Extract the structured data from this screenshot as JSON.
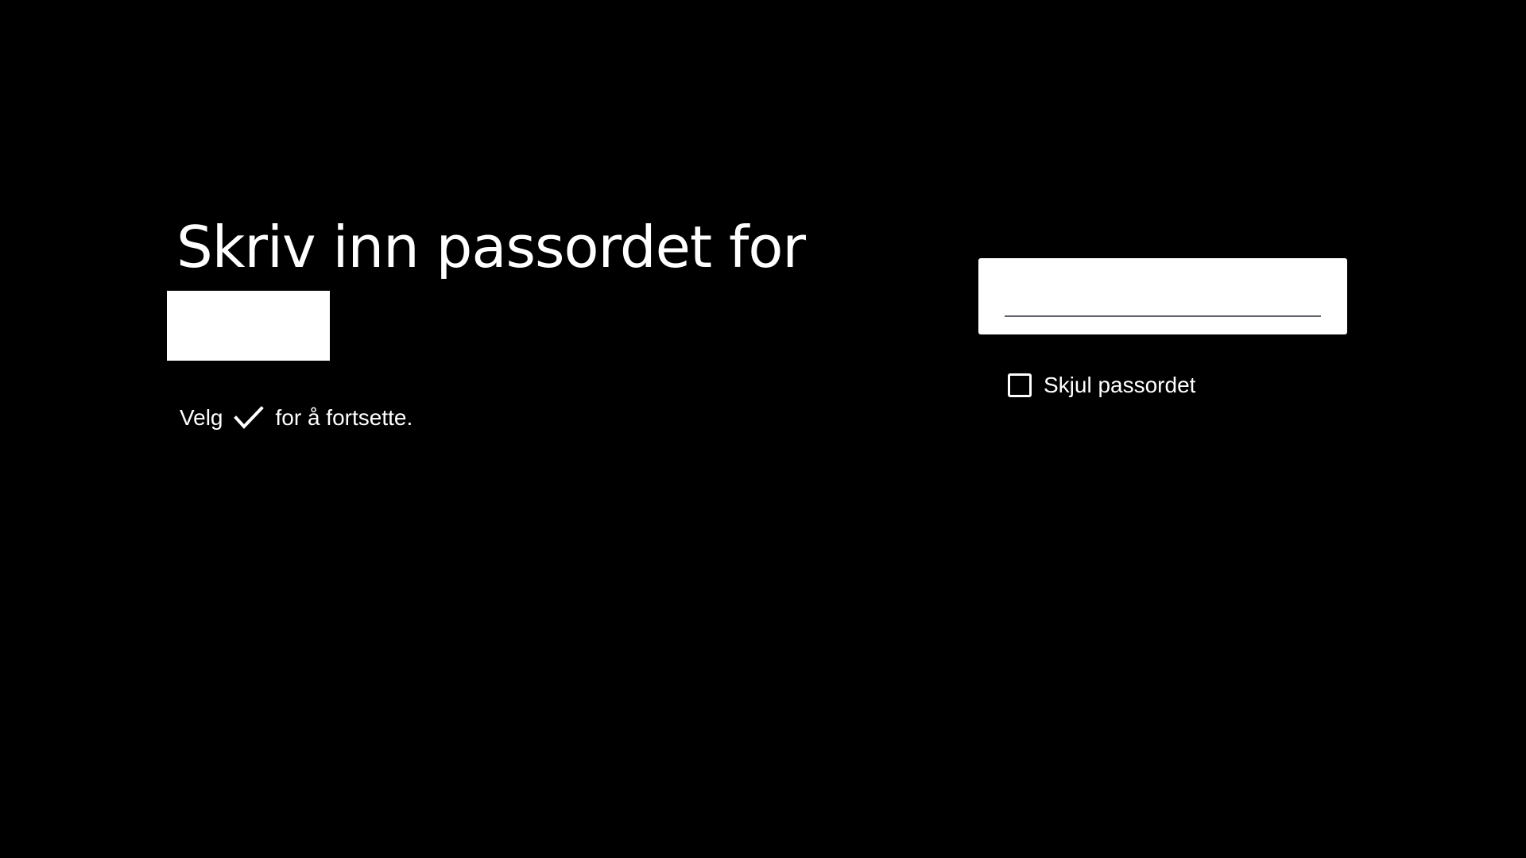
{
  "dialog": {
    "title": "Skriv inn passordet for",
    "hint_before": "Velg",
    "hint_icon": "checkmark-icon",
    "hint_after": "for å fortsette."
  },
  "password": {
    "value": "",
    "placeholder": ""
  },
  "hide_password": {
    "label": "Skjul passordet",
    "checked": false,
    "icon": "checkbox-unchecked-icon"
  },
  "colors": {
    "background": "#000000",
    "text": "#ffffff",
    "field_background": "#ffffff",
    "field_underline": "#5f6368"
  }
}
